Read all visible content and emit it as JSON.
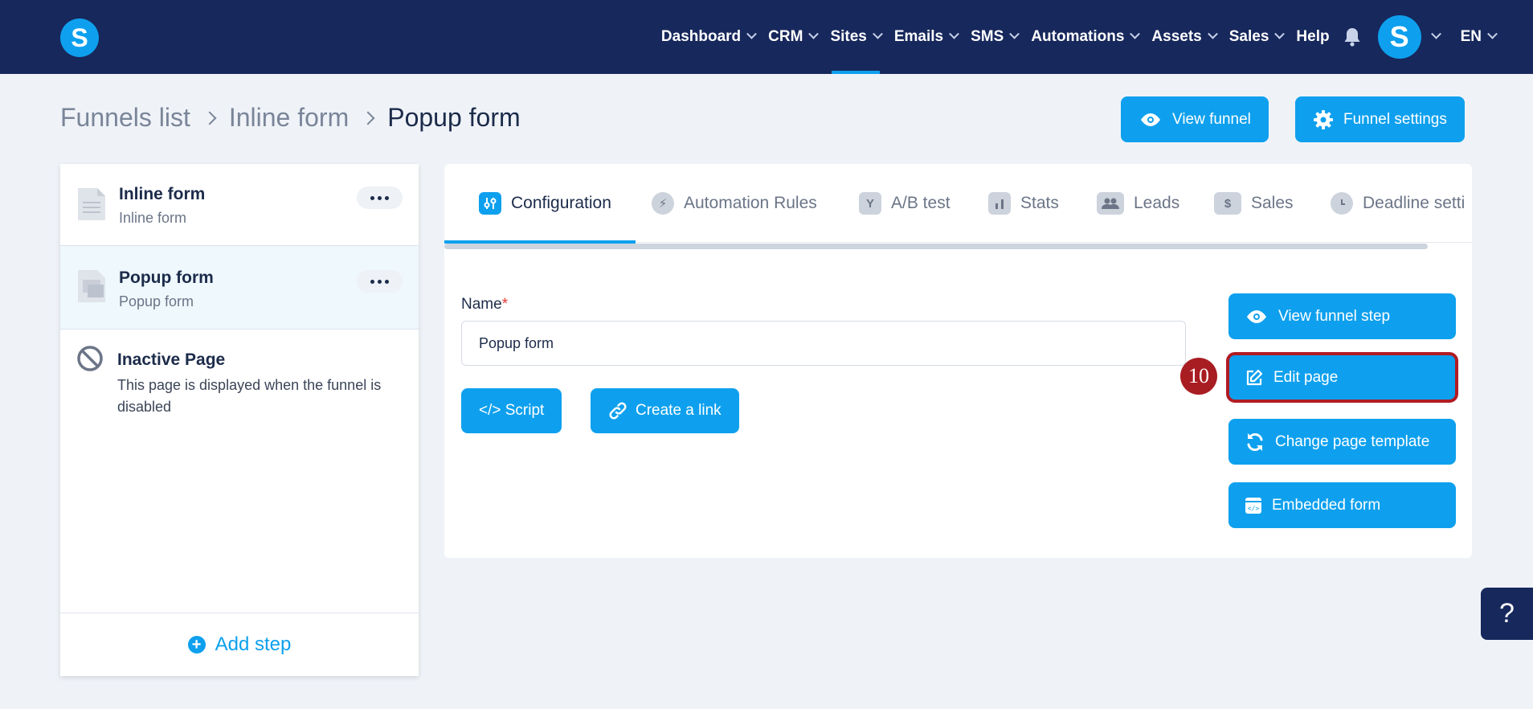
{
  "logo": {
    "letter": "S"
  },
  "nav": {
    "items": [
      {
        "label": "Dashboard"
      },
      {
        "label": "CRM"
      },
      {
        "label": "Sites"
      },
      {
        "label": "Emails"
      },
      {
        "label": "SMS"
      },
      {
        "label": "Automations"
      },
      {
        "label": "Assets"
      },
      {
        "label": "Sales"
      }
    ],
    "active": "Sites",
    "help": "Help",
    "avatar_letter": "S",
    "language": "EN"
  },
  "breadcrumb": {
    "items": [
      "Funnels list",
      "Inline form",
      "Popup form"
    ]
  },
  "header_actions": {
    "view_funnel": "View funnel",
    "funnel_settings": "Funnel settings"
  },
  "steps": [
    {
      "title": "Inline form",
      "subtitle": "Inline form",
      "selected": false
    },
    {
      "title": "Popup form",
      "subtitle": "Popup form",
      "selected": true
    }
  ],
  "inactive_page": {
    "title": "Inactive Page",
    "description": "This page is displayed when the funnel is disabled"
  },
  "add_step": "Add step",
  "tabs": [
    {
      "label": "Configuration",
      "icon": "sliders-icon",
      "active": true
    },
    {
      "label": "Automation Rules",
      "icon": "bolt-icon"
    },
    {
      "label": "A/B test",
      "icon": "split-icon"
    },
    {
      "label": "Stats",
      "icon": "bar-chart-icon"
    },
    {
      "label": "Leads",
      "icon": "users-icon"
    },
    {
      "label": "Sales",
      "icon": "dollar-icon"
    },
    {
      "label": "Deadline setti",
      "icon": "clock-icon"
    }
  ],
  "form": {
    "name_label": "Name",
    "required_mark": "*",
    "name_value": "Popup form"
  },
  "actions": {
    "script": "</> Script",
    "create_link": "Create a link"
  },
  "side_actions": {
    "view_step": "View funnel step",
    "edit_page": "Edit page",
    "change_template": "Change page template",
    "embedded_form": "Embedded form"
  },
  "annotation": {
    "step_number": "10"
  },
  "help_widget": "?",
  "colors": {
    "nav_bg": "#17285c",
    "accent": "#0ea0ee",
    "highlight": "#b01c24"
  }
}
